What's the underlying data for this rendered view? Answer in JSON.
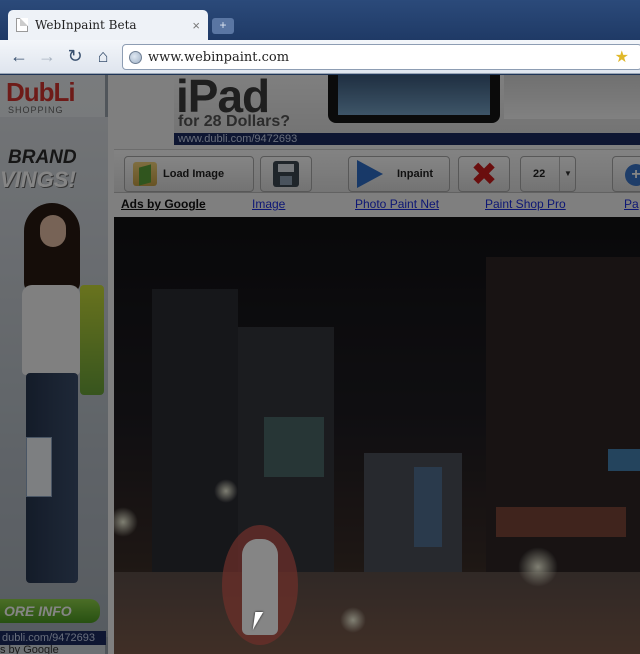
{
  "browser": {
    "tab_title": "WebInpaint Beta",
    "tab_close": "×",
    "new_tab": "+",
    "url": "www.webinpaint.com",
    "back_icon": "←",
    "forward_icon": "→",
    "reload_icon": "↻",
    "home_icon": "⌂",
    "star_icon": "★"
  },
  "left_ad": {
    "logo": "DubLi",
    "logo_sub": "SHOPPING",
    "line1": "BRAND",
    "line2": "VINGS!",
    "cta": "ORE INFO",
    "url": "dubli.com/9472693",
    "ads_by": "s by Google"
  },
  "top_ad": {
    "headline": "iPad",
    "sub": "for 28 Dollars?",
    "url": "www.dubli.com/9472693"
  },
  "app": {
    "load_label": "Load Image",
    "inpaint_label": "Inpaint",
    "brush_size": "22",
    "dropdown_arrow": "▼",
    "zoom_plus": "+",
    "ads_by": "Ads by Google",
    "links": [
      "Image",
      "Photo Paint Net",
      "Paint Shop Pro",
      "Pa"
    ]
  },
  "colors": {
    "mask": "#cd5a50",
    "brand_blue": "#1b2b60",
    "link": "#1a2ce0"
  }
}
